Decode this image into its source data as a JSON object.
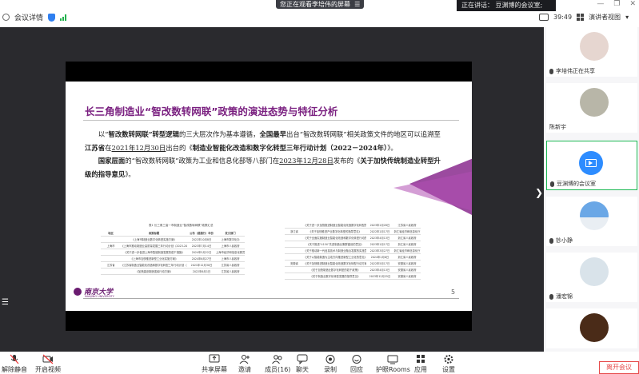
{
  "topbar": {
    "meeting_details": "会议详情",
    "viewing_banner": "您正在观看李培伟的屏幕",
    "viewing_banner_icon": "menu-icon",
    "speaking_banner": "正在讲话：  豆渊博的会议室;",
    "time": "39:49",
    "speaker_view": "演讲者视图"
  },
  "slide": {
    "title": "长三角制造业“智改数转网联”政策的演进态势与特征分析",
    "p1_a": "以“",
    "p1_b": "智改数转网联”转型逻辑",
    "p1_c": "的三大层次作为基本遵循，",
    "p1_d": "全国最早",
    "p1_e": "出台“智改数转网联”相关政策文件的地区可以追溯至",
    "p1_f": "江苏省",
    "p1_g": "在",
    "p1_h": "2021年12月30日",
    "p1_i": "出台的《",
    "p1_j": "制造业智能化改造和数字化转型三年行动计划（2022－2024年）",
    "p1_k": "》。",
    "p2_a": "国家层面",
    "p2_b": "的“智改数转网联”政策为工业和信息化部等八部门在",
    "p2_c": "2023年12月28日",
    "p2_d": "发布的《",
    "p2_e": "关于加快传统制造业转型升级的指导意见",
    "p2_f": "》。",
    "table_caption": "表1 长三角三省一市制造业“智改数转网联”政策汇总",
    "left_table_headers": [
      "地区",
      "政策标题",
      "公布（或施行）年份",
      "发文部门"
    ],
    "left_table_rows": [
      [
        "",
        "《上海市制造业数字化转型实施方案》",
        "2022年10月8日",
        "上海市数字化办"
      ],
      [
        "上海市",
        "《上海市推动制造业高质量发展三年行动计划（2023-2025年）》",
        "2023年7月14日",
        "上海市人民政府"
      ],
      [
        "",
        "《关于进一步促进上海市智能制造发展的若干措施》",
        "2024年5月22日",
        "上海市经济和信息化委员会等"
      ],
      [
        "",
        "《上海市加快推进新型工业化实施方案》",
        "2024年6月27日",
        "上海市人民政府"
      ],
      [
        "江苏省",
        "《江苏省制造业智能化改造和数字化转型三年行动计划（2022－2024年）》",
        "2021年12月30日",
        "江苏省人民政府"
      ],
      [
        "",
        "《加快建设制造强省行动方案》",
        "2022年6月1日",
        "江苏省人民政府"
      ]
    ],
    "right_table_rows": [
      [
        "",
        "《关于进一步加快推进制造业智能化改造数字化转型的实施意见》",
        "2023年1月28日",
        "江苏省人民政府"
      ],
      [
        "浙江省",
        "《关于加快推进产业数字化转型的指导意见》",
        "2022年1月17日",
        "浙江省经济和信息化厅"
      ],
      [
        "",
        "《关于全面实施制造业智能化改造和数字化转型行动的指导意见》",
        "2023年4月13日",
        "浙江省人民政府"
      ],
      [
        "",
        "《关于推进“415X”先进制造业集群建设的意见》",
        "2023年1月17日",
        "浙江省人民政府"
      ],
      [
        "",
        "《关于推动新一代信息技术与制造业融合发展的实施意见》",
        "2023年3月27日",
        "浙江省经济和信息化厅"
      ],
      [
        "",
        "《关于以智能制造为主攻方向推进新型工业化的意见》",
        "2024年1月6日",
        "浙江省人民政府"
      ],
      [
        "安徽省",
        "《关于加快推进制造业智能化改造数字化转型行动方案》",
        "2022年5月17日",
        "安徽省人民政府"
      ],
      [
        "",
        "《关于加快制造业数字化转型的若干政策》",
        "2023年4月13日",
        "安徽省人民政府"
      ],
      [
        "",
        "《关于制造业数字化转型发展的指导意见》",
        "2023年12月25日",
        "安徽省人民政府"
      ]
    ],
    "univ_name": "南京大学",
    "univ_sub": "NANJING UNIVERSITY",
    "page_number": "5"
  },
  "participants": [
    {
      "name": "李培伟正在共享",
      "status": "sharing"
    },
    {
      "name": "陈新宇",
      "status": ""
    },
    {
      "name": "豆渊博的会议室",
      "status": "speaking"
    },
    {
      "name": "钞小静",
      "status": ""
    },
    {
      "name": "潘宏锦",
      "status": ""
    },
    {
      "name": "",
      "status": ""
    }
  ],
  "toolbar": {
    "items": [
      "解除静音",
      "开启视频",
      "共享屏幕",
      "邀请",
      "成员(16)",
      "聊天",
      "录制",
      "回应",
      "护眼Rooms",
      "应用",
      "设置"
    ],
    "leave": "离开会议"
  },
  "colors": {
    "accent": "#2d8cff",
    "title_purple": "#7a2080",
    "leave_red": "#e64a4a",
    "speaking_green": "#1db954"
  }
}
